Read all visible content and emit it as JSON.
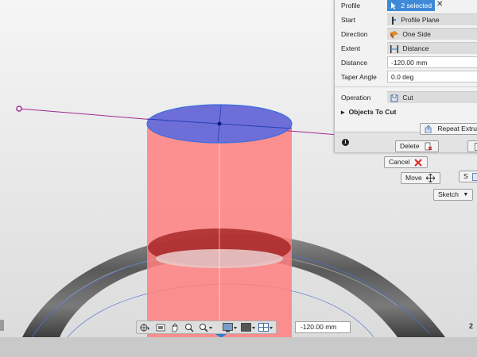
{
  "dialog": {
    "profile_label": "Profile",
    "profile_value": "2 selected",
    "start_label": "Start",
    "start_value": "Profile Plane",
    "direction_label": "Direction",
    "direction_value": "One Side",
    "extent_label": "Extent",
    "extent_value": "Distance",
    "distance_label": "Distance",
    "distance_value": "-120.00 mm",
    "taper_label": "Taper Angle",
    "taper_value": "0.0 deg",
    "operation_label": "Operation",
    "operation_value": "Cut",
    "objects_to_cut": "Objects To Cut"
  },
  "marking_menu": {
    "repeat": "Repeat Extrude",
    "delete": "Delete",
    "cancel": "Cancel",
    "move": "Move",
    "sketch": "Sketch"
  },
  "viewport": {
    "distance_input": "-120.00 mm",
    "right_fragment": "2"
  },
  "colors": {
    "accent": "#3f89d6",
    "cut_body": "#ff7f7f",
    "profile": "#6e6ed8",
    "axis": "#a2288f"
  }
}
